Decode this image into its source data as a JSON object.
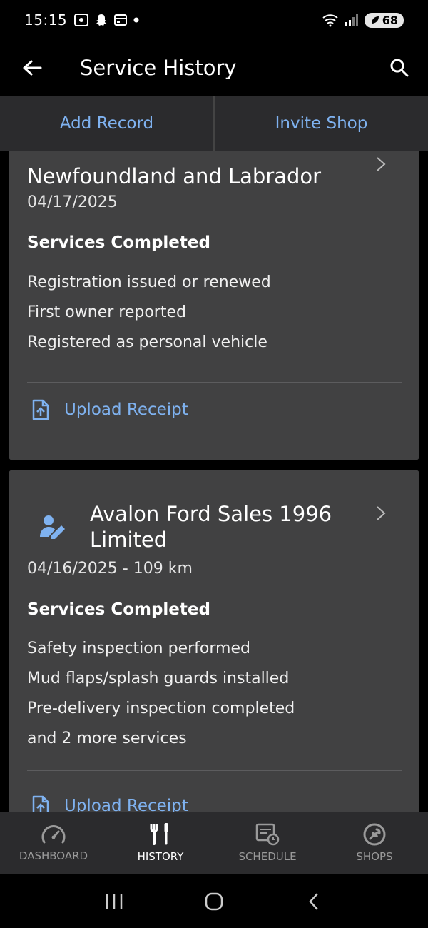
{
  "status_bar": {
    "time": "15:15",
    "battery": "68",
    "notification_icons": [
      "screenshot-icon",
      "snapchat-icon",
      "calendar-icon",
      "dot-icon"
    ]
  },
  "app_bar": {
    "title": "Service History"
  },
  "actions": {
    "add_record": "Add Record",
    "invite_shop": "Invite Shop"
  },
  "records": [
    {
      "title": "Newfoundland and Labrador",
      "date": "04/17/2025",
      "section_heading": "Services Completed",
      "services": [
        "Registration issued or renewed",
        "First owner reported",
        "Registered as personal vehicle"
      ],
      "upload_label": "Upload Receipt"
    },
    {
      "title": "Avalon Ford Sales 1996 Limited",
      "date": "04/16/2025 - 109 km",
      "section_heading": "Services Completed",
      "services": [
        "Safety inspection performed",
        "Mud flaps/splash guards installed",
        "Pre-delivery inspection completed",
        "and 2 more services"
      ],
      "upload_label": "Upload Receipt"
    }
  ],
  "bottom_nav": {
    "items": [
      {
        "label": "DASHBOARD",
        "icon": "speedometer-icon",
        "active": false
      },
      {
        "label": "HISTORY",
        "icon": "wrench-screwdriver-icon",
        "active": true
      },
      {
        "label": "SCHEDULE",
        "icon": "schedule-icon",
        "active": false
      },
      {
        "label": "SHOPS",
        "icon": "shop-wrench-icon",
        "active": false
      }
    ]
  },
  "colors": {
    "accent": "#7fb2f0",
    "card_bg": "#414142",
    "bar_bg": "#2b2b2d",
    "background": "#000000"
  }
}
